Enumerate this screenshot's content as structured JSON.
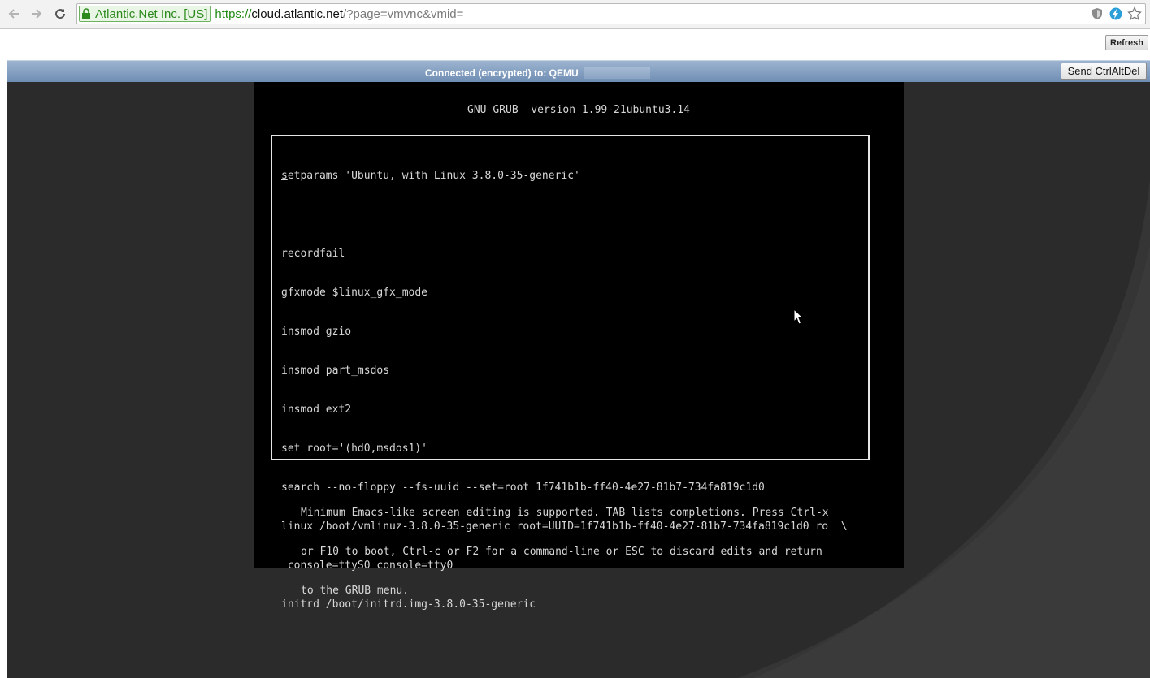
{
  "browser": {
    "ev_label": "Atlantic.Net Inc. [US]",
    "url_scheme": "https://",
    "url_host": "cloud.atlantic.net",
    "url_path": "/?page=vmvnc&vmid="
  },
  "toolbar": {
    "refresh_label": "Refresh"
  },
  "vnc": {
    "status_text": "Connected (encrypted) to: QEMU",
    "send_cad_label": "Send CtrlAltDel"
  },
  "grub": {
    "header": "GNU GRUB  version 1.99-21ubuntu3.14",
    "first_char": "s",
    "first_rest": "etparams 'Ubuntu, with Linux 3.8.0-35-generic'",
    "lines": [
      "",
      "recordfail",
      "gfxmode $linux_gfx_mode",
      "insmod gzio",
      "insmod part_msdos",
      "insmod ext2",
      "set root='(hd0,msdos1)'",
      "search --no-floppy --fs-uuid --set=root 1f741b1b-ff40-4e27-81b7-734fa819c1d0",
      "linux /boot/vmlinuz-3.8.0-35-generic root=UUID=1f741b1b-ff40-4e27-81b7-734fa819c1d0 ro  \\",
      " console=ttyS0 console=tty0",
      "initrd /boot/initrd.img-3.8.0-35-generic"
    ],
    "help": [
      "Minimum Emacs-like screen editing is supported. TAB lists completions. Press Ctrl-x",
      "or F10 to boot, Ctrl-c or F2 for a command-line or ESC to discard edits and return",
      "to the GRUB menu."
    ]
  }
}
